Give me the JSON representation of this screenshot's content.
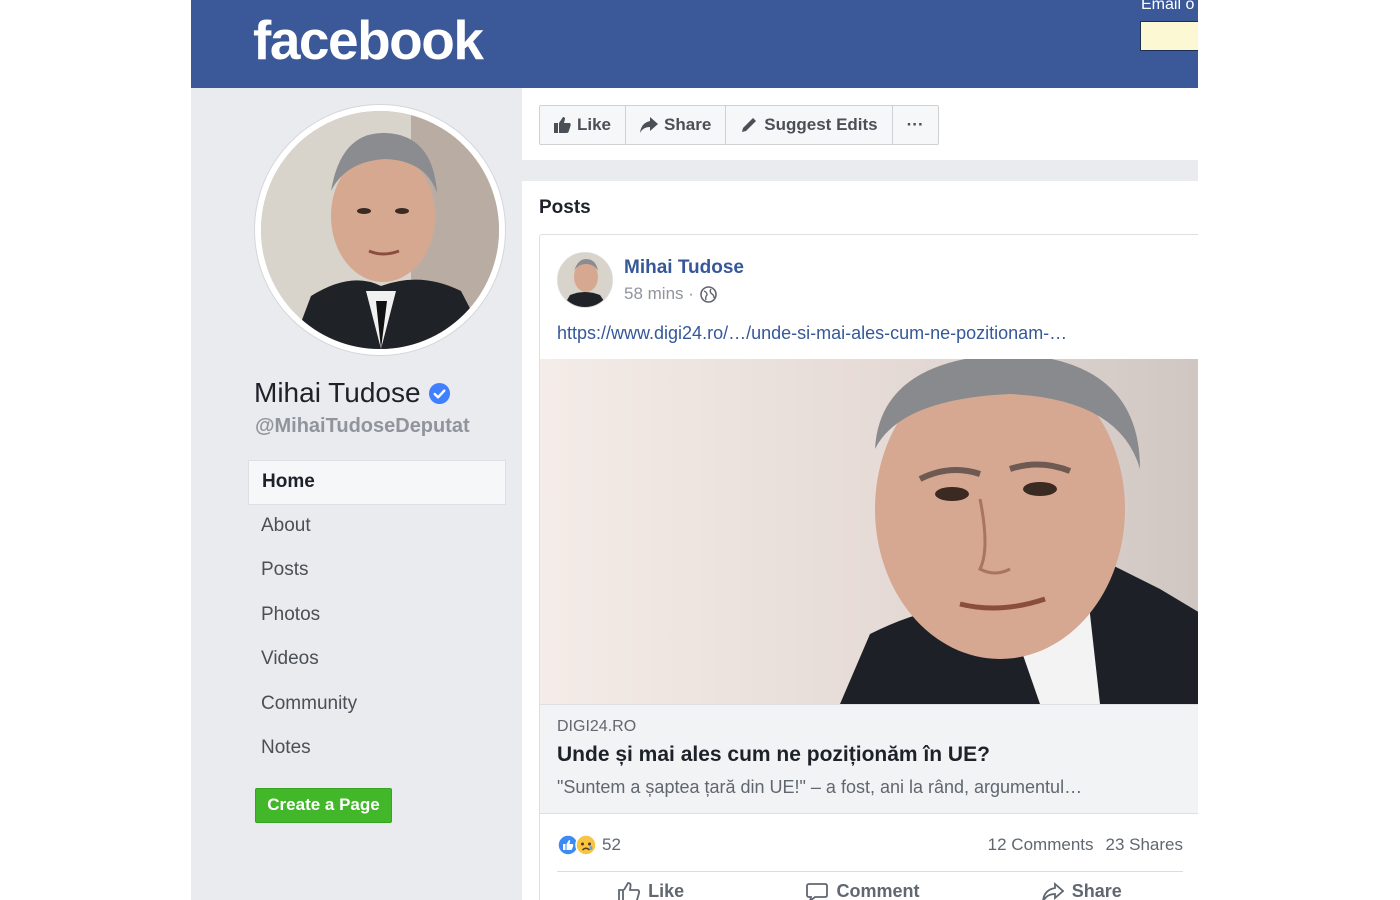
{
  "header": {
    "logo": "facebook",
    "email_label": "Email o",
    "email_value": ""
  },
  "profile": {
    "name": "Mihai Tudose",
    "handle": "@MihaiTudoseDeputat",
    "verified_color": "#4080ff"
  },
  "nav": {
    "items": [
      {
        "label": "Home",
        "active": true
      },
      {
        "label": "About"
      },
      {
        "label": "Posts"
      },
      {
        "label": "Photos"
      },
      {
        "label": "Videos"
      },
      {
        "label": "Community"
      },
      {
        "label": "Notes"
      }
    ],
    "create_page": "Create a Page"
  },
  "actions": {
    "like": "Like",
    "share": "Share",
    "suggest_edits": "Suggest Edits",
    "more": "···"
  },
  "posts": {
    "title": "Posts",
    "post": {
      "author": "Mihai Tudose",
      "time": "58 mins ·",
      "privacy_icon": "globe-icon",
      "link": "https://www.digi24.ro/…/unde-si-mai-ales-cum-ne-pozitionam-…",
      "preview": {
        "domain": "DIGI24.RO",
        "title": "Unde și mai ales cum ne poziționăm în UE?",
        "description": "\"Suntem a șaptea țară din UE!\" – a fost, ani la rând, argumentul…"
      },
      "reactions": {
        "icons": [
          "like-reaction-icon",
          "sad-reaction-icon"
        ],
        "count": "52"
      },
      "comments": "12 Comments",
      "shares": "23 Shares",
      "buttons": {
        "like": "Like",
        "comment": "Comment",
        "share": "Share"
      }
    }
  },
  "colors": {
    "header_bg": "#3b5998",
    "link": "#365899",
    "create_button": "#42b72a"
  }
}
